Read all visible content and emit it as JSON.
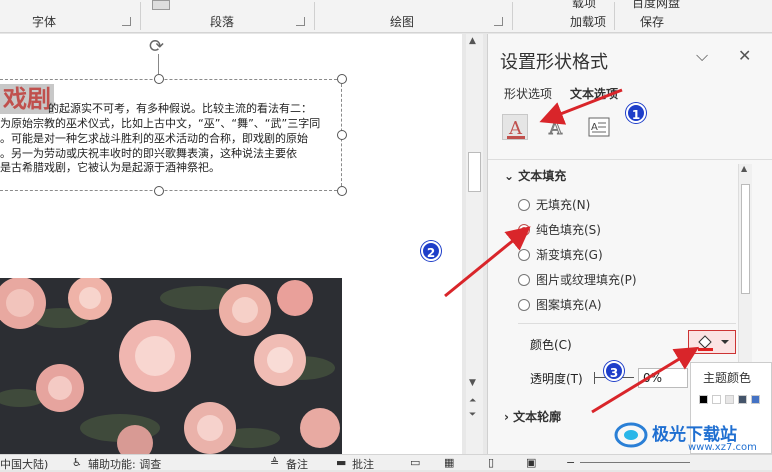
{
  "ribbon": {
    "groups": [
      "字体",
      "段落",
      "绘图",
      "加载项",
      "保存"
    ],
    "top_labels": [
      "载项",
      "百度网盘"
    ]
  },
  "document": {
    "title_word": "戏剧",
    "lines": [
      "的起源实不可考，有多种假说。比较主流的看法有二：",
      "为原始宗教的巫术仪式，比如上古中文，“巫”、“舞”、“武”三字同",
      "。可能是对一种乞求战斗胜利的巫术活动的合称，即戏剧的原始",
      "。另一为劳动或庆祝丰收时的即兴歌舞表演，这种说法主要依",
      "是古希腊戏剧，它被认为是起源于酒神祭祀。"
    ],
    "links": [
      "原始宗教",
      "巫术",
      "巫",
      "舞",
      "武",
      "巫术",
      "古希腊戏剧"
    ]
  },
  "panel": {
    "title": "设置形状格式",
    "tabs": [
      "形状选项",
      "文本选项"
    ],
    "section_fill": "文本填充",
    "fill_options": [
      "无填充(N)",
      "纯色填充(S)",
      "渐变填充(G)",
      "图片或纹理填充(P)",
      "图案填充(A)"
    ],
    "selected_fill": 1,
    "color_label": "颜色(C)",
    "transparency_label": "透明度(T)",
    "transparency_value": "0%",
    "section_outline": "文本轮廓"
  },
  "popup": {
    "title": "主题颜色",
    "swatches": [
      "#000000",
      "#ffffff",
      "#e7e6e6",
      "#44546a",
      "#4472c4",
      "#ed7d31",
      "#a5a5a5",
      "#ffc000"
    ]
  },
  "badges": [
    "1",
    "2",
    "3"
  ],
  "status": {
    "lang": "中国大陆)",
    "accessibility": "辅助功能: 调查",
    "notes": "备注",
    "comments": "批注"
  },
  "watermark": {
    "text": "极光下载站",
    "url": "www.xz7.com"
  },
  "colors": {
    "accent_red": "#c0504d",
    "badge_blue": "#1e3ec9",
    "arrow_red": "#d9252a"
  }
}
